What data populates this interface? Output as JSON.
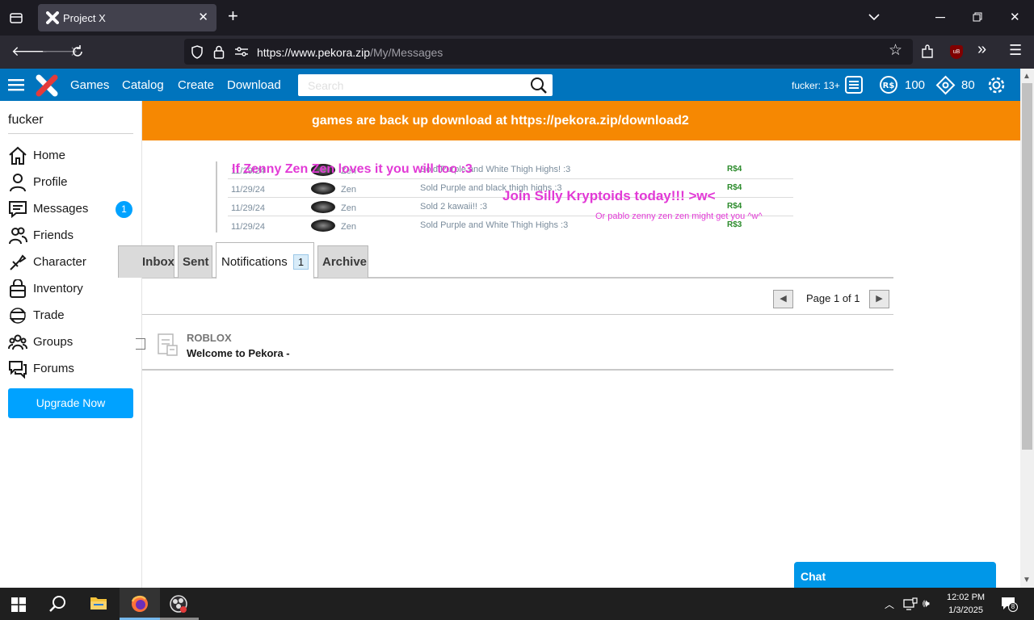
{
  "browser": {
    "tab_title": "Project X",
    "url_host": "https://www.pekora.zip",
    "url_path": "/My/Messages"
  },
  "header": {
    "nav": [
      "Games",
      "Catalog",
      "Create",
      "Download"
    ],
    "search_placeholder": "Search",
    "user_label": "fucker: 13+",
    "robux": "100",
    "tickets": "80"
  },
  "sidebar": {
    "username": "fucker",
    "items": [
      {
        "label": "Home",
        "icon": "home-icon"
      },
      {
        "label": "Profile",
        "icon": "profile-icon"
      },
      {
        "label": "Messages",
        "icon": "messages-icon",
        "badge": "1"
      },
      {
        "label": "Friends",
        "icon": "friends-icon"
      },
      {
        "label": "Character",
        "icon": "character-icon"
      },
      {
        "label": "Inventory",
        "icon": "inventory-icon"
      },
      {
        "label": "Trade",
        "icon": "trade-icon"
      },
      {
        "label": "Groups",
        "icon": "groups-icon"
      },
      {
        "label": "Forums",
        "icon": "forums-icon"
      }
    ],
    "upgrade_label": "Upgrade Now"
  },
  "banner": {
    "text": "games are back up download at https://pekora.zip/download2"
  },
  "ad": {
    "rows": [
      {
        "date": "11/29/24",
        "name": "Zen",
        "text": "Sold Purple and White Thigh Highs! :3",
        "price": "R$4"
      },
      {
        "date": "11/29/24",
        "name": "Zen",
        "text": "Sold Purple and black thigh highs :3",
        "price": "R$4"
      },
      {
        "date": "11/29/24",
        "name": "Zen",
        "text": "Sold 2 kawaii!! :3",
        "price": "R$4"
      },
      {
        "date": "11/29/24",
        "name": "Zen",
        "text": "Sold Purple and White Thigh Highs :3",
        "price": "R$3"
      }
    ],
    "overlay1": "If Zenny Zen Zen  loves it you will too :3",
    "overlay2": "Join Silly Kryptoids today!!! >w<",
    "overlay3": "Or pablo zenny zen zen might get you ^w^"
  },
  "tabs": {
    "inbox": "Inbox",
    "sent": "Sent",
    "notifications": "Notifications",
    "notifications_count": "1",
    "archive": "Archive"
  },
  "pager": {
    "text": "Page 1 of 1"
  },
  "messages": [
    {
      "sender": "ROBLOX",
      "subject": "Welcome to Pekora -"
    }
  ],
  "chat": {
    "label": "Chat"
  },
  "taskbar": {
    "time": "12:02 PM",
    "date": "1/3/2025",
    "notifications": "8"
  },
  "colors": {
    "header_blue": "#0074bd",
    "banner_orange": "#f68802",
    "accent_blue": "#00a2ff",
    "ad_pink": "#e23ad6"
  }
}
